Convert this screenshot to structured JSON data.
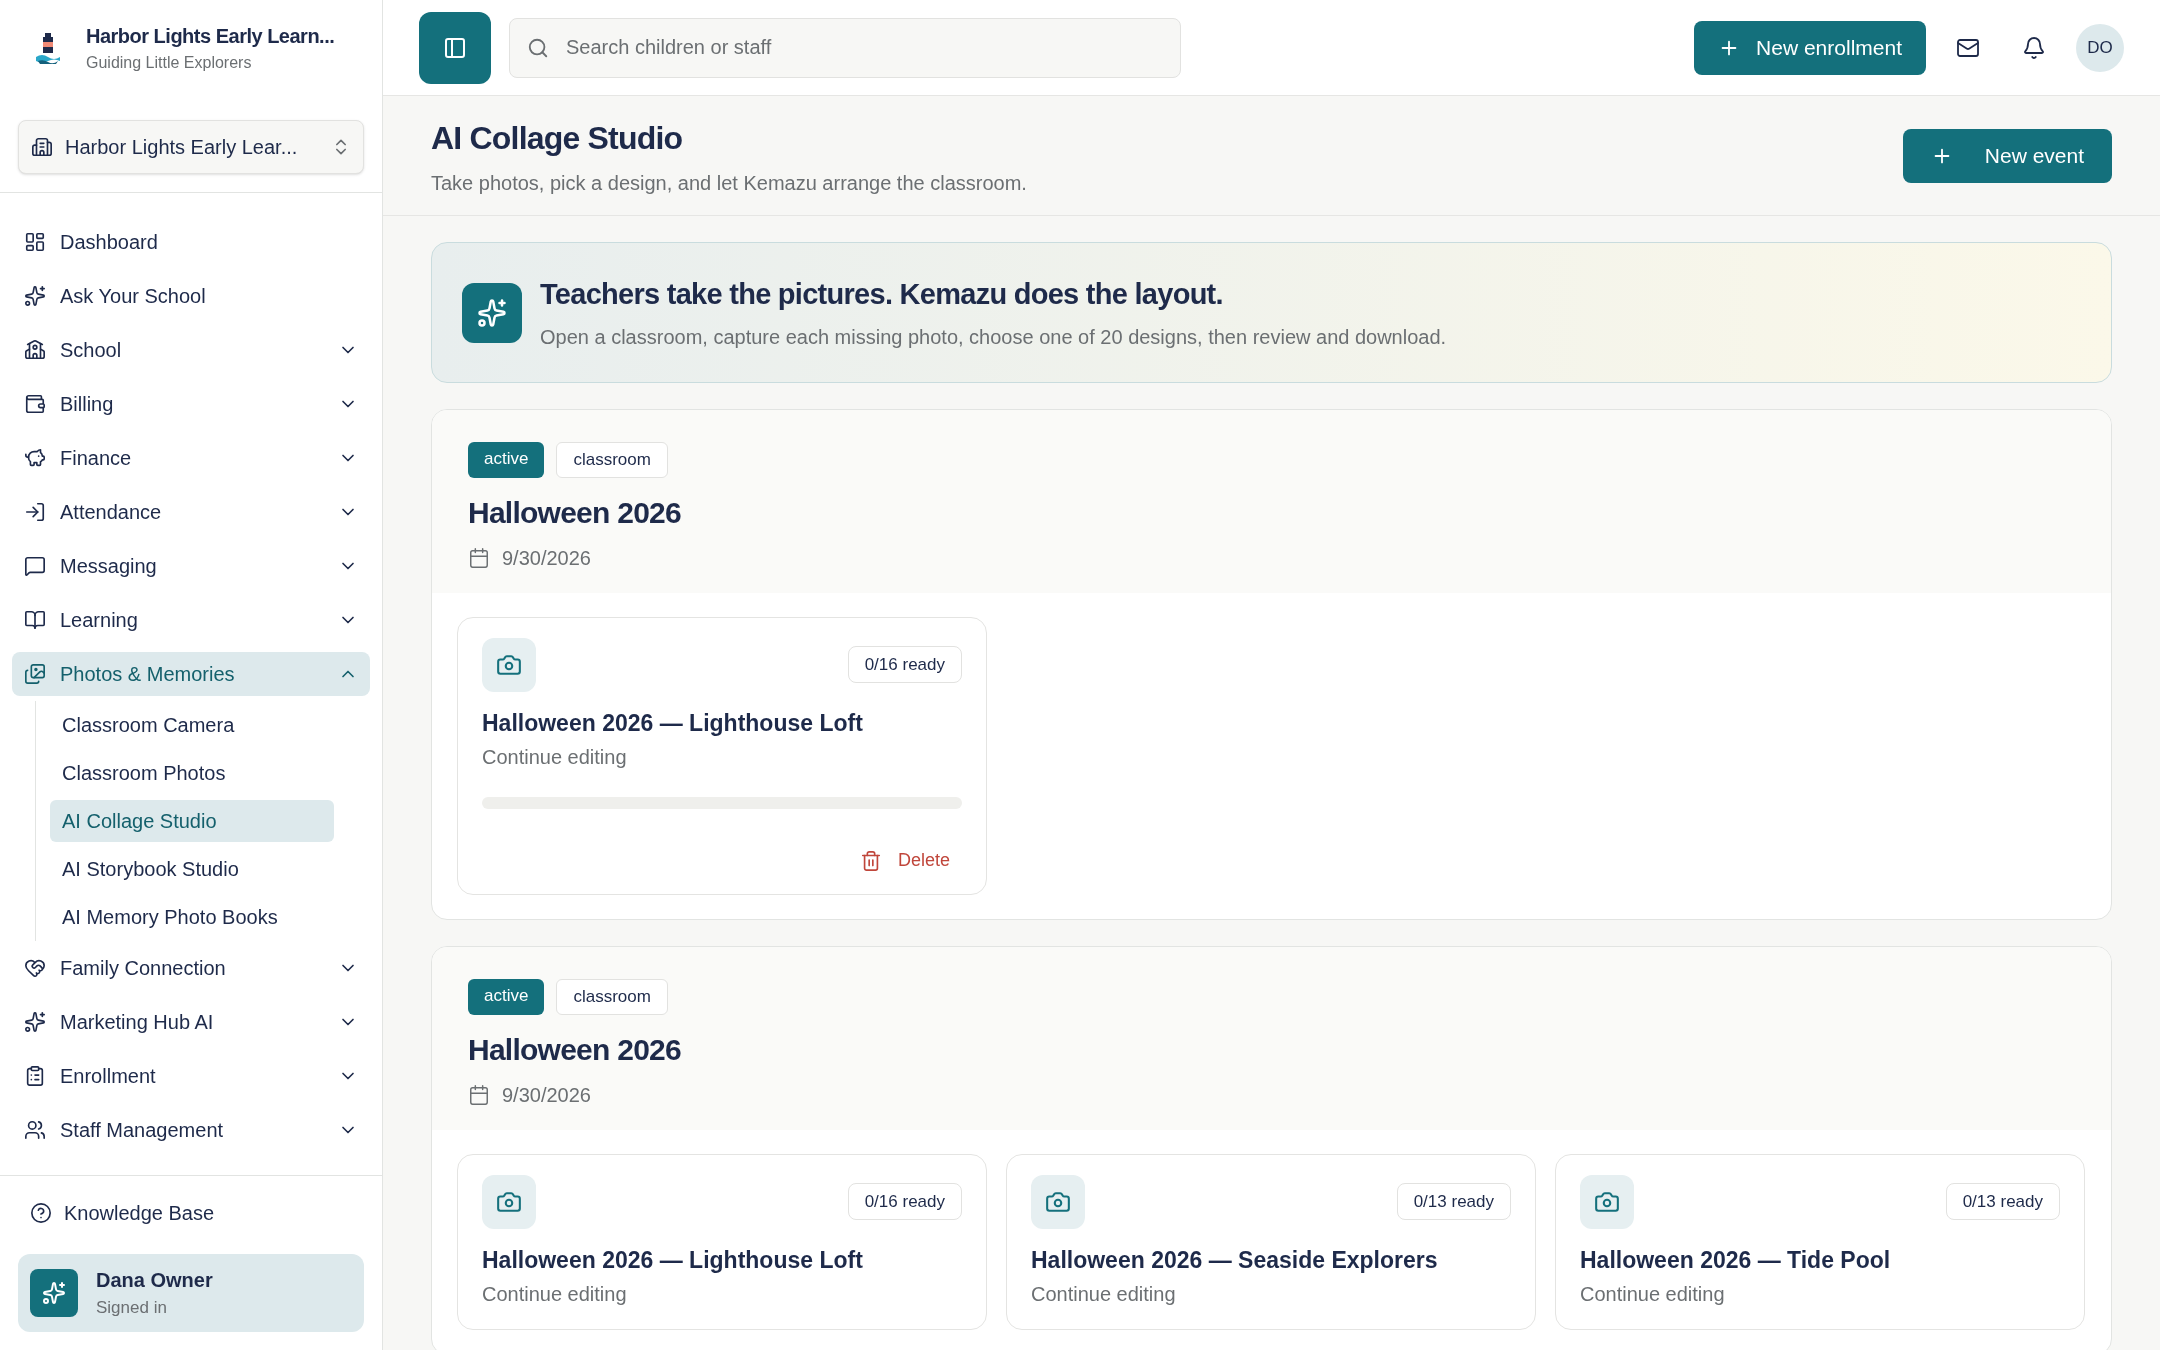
{
  "brand": {
    "name": "Harbor Lights Early Learn...",
    "tagline": "Guiding Little Explorers"
  },
  "school_switcher": {
    "value": "Harbor Lights Early Lear..."
  },
  "nav": [
    {
      "label": "Dashboard",
      "kind": "link",
      "selected": false
    },
    {
      "label": "Ask Your School",
      "kind": "link",
      "selected": false
    },
    {
      "label": "School",
      "kind": "group",
      "selected": false,
      "expanded": false
    },
    {
      "label": "Billing",
      "kind": "group",
      "selected": false,
      "expanded": false
    },
    {
      "label": "Finance",
      "kind": "group",
      "selected": false,
      "expanded": false
    },
    {
      "label": "Attendance",
      "kind": "group",
      "selected": false,
      "expanded": false
    },
    {
      "label": "Messaging",
      "kind": "group",
      "selected": false,
      "expanded": false
    },
    {
      "label": "Learning",
      "kind": "group",
      "selected": false,
      "expanded": false
    },
    {
      "label": "Photos & Memories",
      "kind": "group",
      "selected": true,
      "expanded": true,
      "children": [
        {
          "label": "Classroom Camera",
          "selected": false
        },
        {
          "label": "Classroom Photos",
          "selected": false
        },
        {
          "label": "AI Collage Studio",
          "selected": true
        },
        {
          "label": "AI Storybook Studio",
          "selected": false
        },
        {
          "label": "AI Memory Photo Books",
          "selected": false
        }
      ]
    },
    {
      "label": "Family Connection",
      "kind": "group",
      "selected": false,
      "expanded": false
    },
    {
      "label": "Marketing Hub AI",
      "kind": "group",
      "selected": false,
      "expanded": false
    },
    {
      "label": "Enrollment",
      "kind": "group",
      "selected": false,
      "expanded": false
    },
    {
      "label": "Staff Management",
      "kind": "group",
      "selected": false,
      "expanded": false
    }
  ],
  "footer_link": "Knowledge Base",
  "user": {
    "name": "Dana Owner",
    "status": "Signed in"
  },
  "search": {
    "placeholder": "Search children or staff"
  },
  "primary_action": "New enrollment",
  "avatar_initials": "DO",
  "page": {
    "title": "AI Collage Studio",
    "subtitle": "Take photos, pick a design, and let Kemazu arrange the classroom.",
    "action": "New event"
  },
  "banner": {
    "title": "Teachers take the pictures. Kemazu does the layout.",
    "text": "Open a classroom, capture each missing photo, choose one of 20 designs, then review and download."
  },
  "events": [
    {
      "status": "active",
      "type": "classroom",
      "title": "Halloween 2026",
      "date": "9/30/2026",
      "collages": [
        {
          "title": "Halloween 2026 — Lighthouse Loft",
          "progress": "0/16 ready",
          "action": "Continue editing",
          "level": 0,
          "delete": "Delete"
        }
      ]
    },
    {
      "status": "active",
      "type": "classroom",
      "title": "Halloween 2026",
      "date": "9/30/2026",
      "collages": [
        {
          "title": "Halloween 2026 — Lighthouse Loft",
          "progress": "0/16 ready",
          "action": "Continue editing"
        },
        {
          "title": "Halloween 2026 — Seaside Explorers",
          "progress": "0/13 ready",
          "action": "Continue editing"
        },
        {
          "title": "Halloween 2026 — Tide Pool",
          "progress": "0/13 ready",
          "action": "Continue editing"
        }
      ]
    }
  ]
}
